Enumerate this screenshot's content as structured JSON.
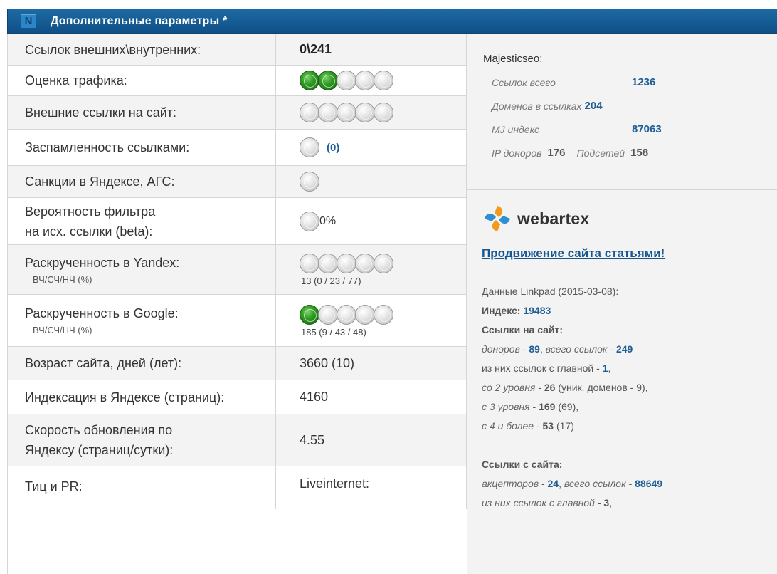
{
  "header": {
    "title": "Дополнительные параметры *",
    "logo_text": "N"
  },
  "rows": [
    {
      "label": "Ссылок внешних\\внутренних:",
      "value": "0\\241"
    },
    {
      "label": "Оценка трафика:",
      "dots_green": 2
    },
    {
      "label": "Внешние ссылки на сайт:",
      "dots_green": 0
    },
    {
      "label": "Заспамленность ссылками:",
      "extra": "(0)"
    },
    {
      "label": "Санкции в Яндексе, АГС:"
    },
    {
      "label_line1": "Вероятность фильтра",
      "label_line2": "на исх. ссылки (beta):",
      "extra": "0%"
    },
    {
      "label": "Раскрученность в Yandex:",
      "sub": "ВЧ/СЧ/НЧ (%)",
      "dots_green": 0,
      "value": "13 (0 / 23 / 77)"
    },
    {
      "label": "Раскрученность в Google:",
      "sub": "ВЧ/СЧ/НЧ (%)",
      "dots_green": 1,
      "value": "185 (9 / 43 / 48)"
    },
    {
      "label": "Возраст сайта, дней (лет):",
      "value": "3660 (10)"
    },
    {
      "label": "Индексация в Яндексе (страниц):",
      "value": "4160"
    },
    {
      "label_line1": "Скорость обновления по",
      "label_line2": "Яндексу (страниц/сутки):",
      "value": "4.55"
    },
    {
      "label": "Тиц и PR:",
      "value": "Liveinternet:"
    }
  ],
  "majestic": {
    "title": "Majesticseo:",
    "links_label": "Ссылок всего",
    "links_value": "1236",
    "domains_label": "Доменов в ссылках",
    "domains_value": "204",
    "mj_label": "MJ индекс",
    "mj_value": "87063",
    "ip_label": "IP доноров",
    "ip_value": "176",
    "subnets_label": "Подсетей",
    "subnets_value": "158"
  },
  "webartex": {
    "name": "webartex",
    "promo_link": "Продвижение сайта статьями!",
    "linkpad_title": "Данные Linkpad (2015-03-08):",
    "index_label": "Индекс:",
    "index_value": "19483",
    "in_title": "Ссылки на сайт:",
    "donors_label": "доноров",
    "donors_value": "89",
    "all_links_label": "всего ссылок",
    "all_links_value": "249",
    "from_main_label": "из них ссылок с главной",
    "from_main_value": "1",
    "lvl2_label": "со 2 уровня",
    "lvl2_value": "26",
    "lvl2_note": "(уник. доменов - 9),",
    "lvl3_label": "с 3 уровня",
    "lvl3_value": "169",
    "lvl3_note": "(69),",
    "lvl4_label": "с 4 и более",
    "lvl4_value": "53",
    "lvl4_note": "(17)",
    "out_title": "Ссылки с сайта:",
    "acceptors_label": "акцепторов",
    "acceptors_value": "24",
    "out_all_label": "всего ссылок",
    "out_all_value": "88649",
    "out_main_label": "из них ссылок с главной",
    "out_main_value": "3"
  }
}
